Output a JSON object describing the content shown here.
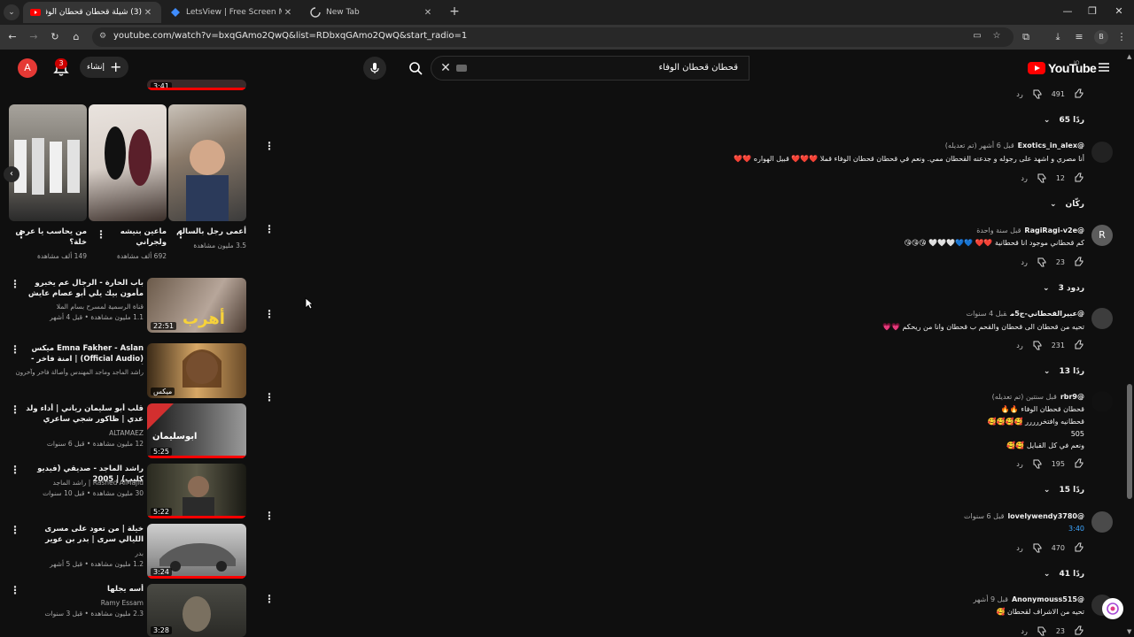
{
  "browser": {
    "tabs": [
      {
        "title": "(3) شيلة قحطان قحطان الوفاء -",
        "close": "✕"
      },
      {
        "title": "LetsView | Free Screen Mirroring",
        "close": "✕"
      },
      {
        "title": "New Tab",
        "close": "✕"
      }
    ],
    "new_tab": "+",
    "url": "youtube.com/watch?v=bxqGAmo2QwQ&list=RDbxqGAmo2QwQ&start_radio=1",
    "profile_initial": "B",
    "window_controls": [
      "—",
      "❐",
      "✕"
    ]
  },
  "header": {
    "avatar_initial": "A",
    "notification_count": "3",
    "create_label": "إنشاء",
    "search_value": "قحطان قحطان الوفاء",
    "logo_text": "YouTube",
    "country_code": "JO"
  },
  "related": {
    "shorts": [
      {
        "title": "أعمى رجل بالسالم",
        "views": "3.5 مليون مشاهدة"
      },
      {
        "title": "ماعين بنيشه ولجراني",
        "views": "692 ألف مشاهدة"
      },
      {
        "title": "من يحاسب يا عرض خلة؟",
        "views": "149 ألف مشاهدة"
      }
    ],
    "top_partial_duration": "3:41",
    "videos": [
      {
        "title": "باب الحارة - الرجال عم يخبرو مأمون بيك يلي أبو عصام عايش وهن ما بيصدقو بلي ...",
        "channel": "قناة الرسمية لمسرح بسام الملا",
        "meta": "1.1 مليون مشاهدة • قبل 4 أشهر",
        "duration": "22:51"
      },
      {
        "title": "Emna Fakher - Aslan ميكس (Official Audio) | امنة فاخر - أصلاً",
        "channel": "راشد الماجد وماجد المهندس وأصالة فاخر وآخرون",
        "meta": "",
        "duration": "ميكس"
      },
      {
        "title": "قلب أبو سليمان رياني | أداء ولد عدي | ظاكور شجي ساعري #شال",
        "channel": "ALTAMAEZ ",
        "meta": "12 مليون مشاهدة • قبل 6 سنوات",
        "duration": "5:25"
      },
      {
        "title": "راشد الماجد - صديقي (فيديو كليب) | 2005",
        "channel": "Rashed AlMajid | راشد الماجد",
        "meta": "30 مليون مشاهدة • قبل 10 سنوات",
        "duration": "5:22"
      },
      {
        "title": "خيلة | من تعود على مسرى الليالي سرى | بدر بن عوير مسرعه",
        "channel": "بدر",
        "meta": "1.2 مليون مشاهدة • قبل 5 أشهر",
        "duration": "3:24"
      },
      {
        "title": "أسه يجلها",
        "channel": "Ramy Essam",
        "meta": "2.3 مليون مشاهدة • قبل 3 سنوات",
        "duration": "3:28"
      }
    ]
  },
  "comments": [
    {
      "kind": "tail",
      "likes": "491",
      "reply": "رد",
      "replies": "65 ردًا"
    },
    {
      "kind": "full",
      "author": "@Exotics_in_alex",
      "time": "قبل 6 أشهر (تم تعديله)",
      "text": "أنا مصري و اشهد على رجوله و جدعنه القحطان ممي. ونعم في قحطان  قحطان الوفاء قملا ❤️❤️❤️ قبيل الهواره ❤️❤️",
      "likes": "12",
      "reply": "رد",
      "replies": "ركّان",
      "avatar": ""
    },
    {
      "kind": "full",
      "author": "@RagiRagi-v2e",
      "time": "قبل سنة واحدة",
      "text": "كم قحطاني موجود انا قحطانية ❤️❤️ 💙💙🤍🤍🤍 😘😘😘",
      "likes": "23",
      "reply": "رد",
      "replies": "3 ردود",
      "avatar": "R"
    },
    {
      "kind": "full",
      "author": "@عبيرالقحطاني-ج5م",
      "time": "قبل 4 سنوات",
      "text": "تحيه من قحطان الى قحطان والقحم ب قحطان وانا من ريحكم 💗💗",
      "likes": "231",
      "reply": "رد",
      "replies": "13 ردًا",
      "avatar": ""
    },
    {
      "kind": "multi",
      "author": "@rbr9",
      "time": "قبل سنتين (تم تعديله)",
      "lines": [
        "قحطان قحطان الوفاء 🔥🔥",
        "قحطانيه وافتخررررر 🥰🥰🥰🥰",
        "505",
        "ونعم في كل القبايل 🥰🥰"
      ],
      "likes": "195",
      "reply": "رد",
      "replies": "15 ردًا",
      "avatar": ""
    },
    {
      "kind": "full",
      "author": "@lovelywendy3780",
      "time": "قبل 6 سنوات",
      "text": "3:40",
      "likes": "470",
      "reply": "رد",
      "replies": "41 ردًا",
      "avatar": ""
    },
    {
      "kind": "full",
      "author": "@Anonymouss515",
      "time": "قبل 9 أشهر",
      "text": "تحيه من الاشراف لقحطان 🥰",
      "likes": "23",
      "reply": "رد",
      "replies": "",
      "avatar": ""
    }
  ]
}
